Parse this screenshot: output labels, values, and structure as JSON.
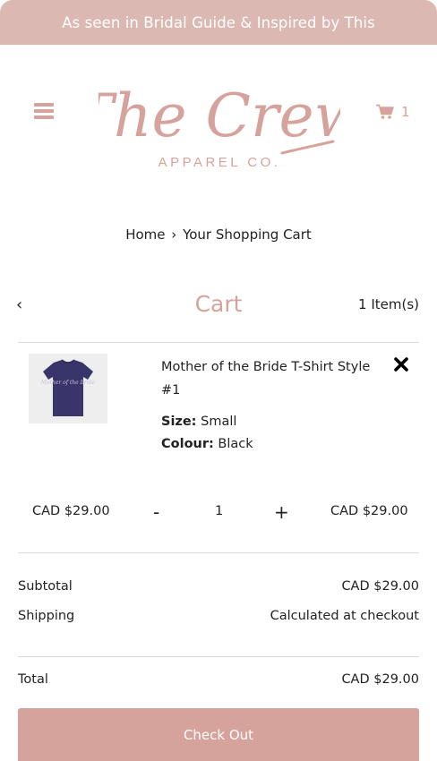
{
  "announcement": "As seen in Bridal Guide & Inspired by This",
  "header": {
    "logo_main": "The Crew",
    "logo_sub": "APPAREL CO.",
    "cart_count": "1"
  },
  "breadcrumb": {
    "home": "Home",
    "separator": "›",
    "current": "Your Shopping Cart"
  },
  "cart": {
    "back_symbol": "‹",
    "title": "Cart",
    "item_count": "1 Item(s)"
  },
  "item": {
    "name": "Mother of the Bride T-Shirt Style #1",
    "size_label": "Size:",
    "size_value": "Small",
    "colour_label": "Colour:",
    "colour_value": "Black",
    "unit_price": "CAD $29.00",
    "minus": "-",
    "quantity": "1",
    "plus": "+",
    "line_total": "CAD $29.00",
    "shirt_print": "Mother of the Bride"
  },
  "summary": {
    "subtotal_label": "Subtotal",
    "subtotal_value": "CAD $29.00",
    "shipping_label": "Shipping",
    "shipping_value": "Calculated at checkout",
    "total_label": "Total",
    "total_value": "CAD $29.00"
  },
  "checkout_label": "Check Out",
  "colors": {
    "brand_pink": "#d6a39c",
    "announcement_bg": "#dbb8b2",
    "shirt_navy": "#39356b"
  },
  "icons": {
    "menu": "hamburger-menu-icon",
    "cart": "shopping-cart-icon",
    "remove": "close-x-icon",
    "back": "chevron-left-icon"
  }
}
